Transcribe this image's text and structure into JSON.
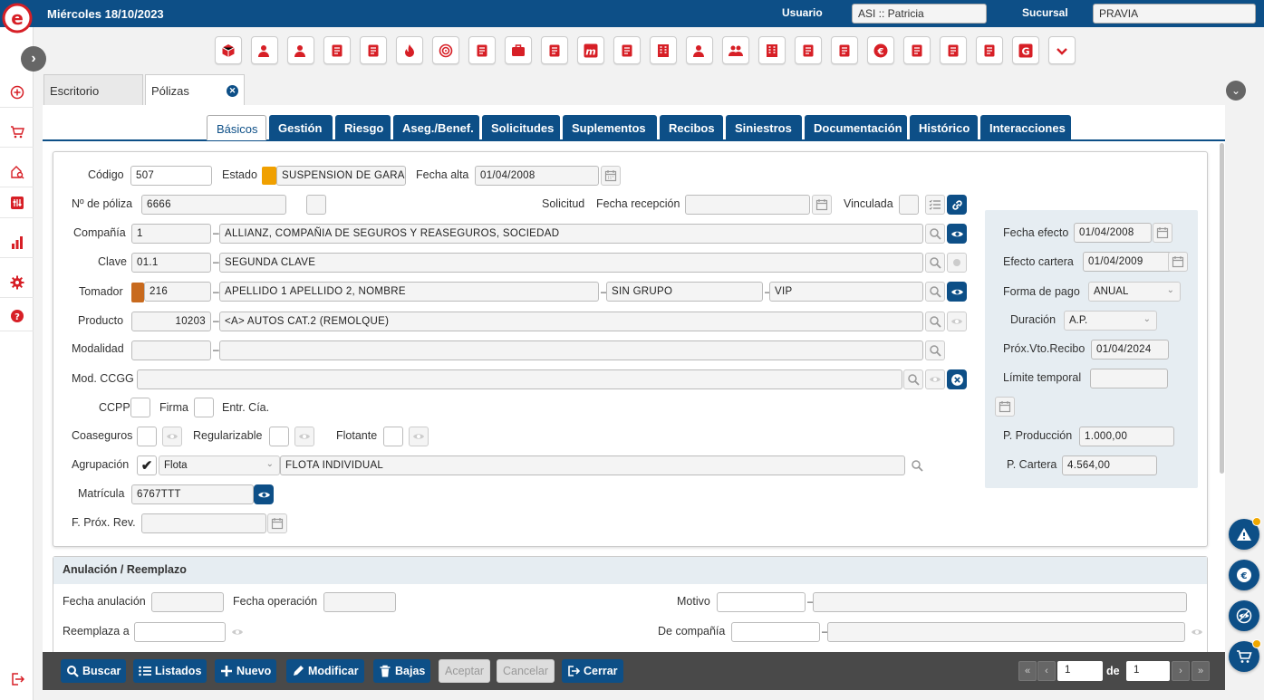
{
  "header": {
    "date": "Miércoles 18/10/2023",
    "user_label": "Usuario",
    "user_value": "ASI :: Patricia",
    "branch_label": "Sucursal",
    "branch_value": "PRAVIA"
  },
  "colors": {
    "primary": "#0d4f87",
    "accent_red": "#d71f26",
    "status_orange": "#f0a000",
    "tomador_brown": "#c86a1e"
  },
  "leftbar": {
    "items": [
      "plus-circle-icon",
      "cart-icon",
      "home-search-icon",
      "sliders-icon",
      "chart-icon",
      "gear-icon",
      "help-icon"
    ],
    "bottom": "logout-icon"
  },
  "toolbar_icons": [
    "cube-icon",
    "user-question-icon",
    "user-check-icon",
    "document-icon",
    "list-document-icon",
    "flame-icon",
    "target-icon",
    "money-icon",
    "briefcase-icon",
    "shopping-bag-icon",
    "m-logo-icon",
    "home-user-icon",
    "building-icon",
    "person-icon",
    "group-icon",
    "building-search-icon",
    "euro-cycle-icon",
    "people-arrow-icon",
    "euro-icon",
    "euro-up-icon",
    "euro-down-icon",
    "eye-slash-icon",
    "g-logo-icon",
    "chevron-down-icon"
  ],
  "window_tabs": [
    {
      "label": "Escritorio"
    },
    {
      "label": "Pólizas"
    }
  ],
  "section_tabs": [
    {
      "label": "Básicos"
    },
    {
      "label": "Gestión"
    },
    {
      "label": "Riesgo"
    },
    {
      "label": "Aseg./Benef."
    },
    {
      "label": "Solicitudes"
    },
    {
      "label": "Suplementos"
    },
    {
      "label": "Recibos"
    },
    {
      "label": "Siniestros"
    },
    {
      "label": "Documentación"
    },
    {
      "label": "Histórico"
    },
    {
      "label": "Interacciones"
    }
  ],
  "form": {
    "codigo_label": "Código",
    "codigo": "507",
    "estado_label": "Estado",
    "estado": "SUSPENSION DE GARANTI",
    "fecha_alta_label": "Fecha alta",
    "fecha_alta": "01/04/2008",
    "num_poliza_label": "Nº de póliza",
    "num_poliza": "6666",
    "solicitud_label": "Solicitud",
    "fecha_recepcion_label": "Fecha recepción",
    "fecha_recepcion": "",
    "vinculada_label": "Vinculada",
    "compania_label": "Compañía",
    "compania_code": "1",
    "compania_name": "ALLIANZ, COMPAÑIA DE SEGUROS Y REASEGUROS, SOCIEDAD",
    "clave_label": "Clave",
    "clave_code": "01.1",
    "clave_name": "SEGUNDA CLAVE",
    "tomador_label": "Tomador",
    "tomador_code": "216",
    "tomador_name": "APELLIDO 1 APELLIDO 2, NOMBRE",
    "tomador_group": "SIN GRUPO",
    "tomador_class": "VIP",
    "producto_label": "Producto",
    "producto_code": "10203",
    "producto_name": "<A> AUTOS CAT.2 (REMOLQUE)",
    "modalidad_label": "Modalidad",
    "mod_ccgg_label": "Mod. CCGG",
    "ccpp_label": "CCPP",
    "firma_label": "Firma",
    "entr_cia_label": "Entr. Cía.",
    "coaseguros_label": "Coaseguros",
    "regularizable_label": "Regularizable",
    "flotante_label": "Flotante",
    "agrupacion_label": "Agrupación",
    "agrupacion_check": "✔",
    "agrupacion_type": "Flota",
    "agrupacion_name": "FLOTA INDIVIDUAL",
    "matricula_label": "Matrícula",
    "matricula": "6767TTT",
    "f_prox_rev_label": "F. Próx. Rev."
  },
  "right_panel": {
    "fecha_efecto_label": "Fecha efecto",
    "fecha_efecto": "01/04/2008",
    "efecto_cartera_label": "Efecto cartera",
    "efecto_cartera": "01/04/2009",
    "forma_pago_label": "Forma de pago",
    "forma_pago": "ANUAL",
    "duracion_label": "Duración",
    "duracion": "A.P.",
    "prox_vto_label": "Próx.Vto.Recibo",
    "prox_vto": "01/04/2024",
    "limite_temporal_label": "Límite temporal",
    "p_produccion_label": "P. Producción",
    "p_produccion": "1.000,00",
    "p_cartera_label": "P. Cartera",
    "p_cartera": "4.564,00"
  },
  "anulacion": {
    "title": "Anulación / Reemplazo",
    "fecha_anulacion_label": "Fecha anulación",
    "fecha_operacion_label": "Fecha operación",
    "motivo_label": "Motivo",
    "reemplaza_label": "Reemplaza a",
    "de_compania_label": "De compañía"
  },
  "bottombar": {
    "buscar": "Buscar",
    "listados": "Listados",
    "nuevo": "Nuevo",
    "modificar": "Modificar",
    "bajas": "Bajas",
    "aceptar": "Aceptar",
    "cancelar": "Cancelar",
    "cerrar": "Cerrar",
    "page": "1",
    "of_label": "de",
    "total": "1"
  }
}
